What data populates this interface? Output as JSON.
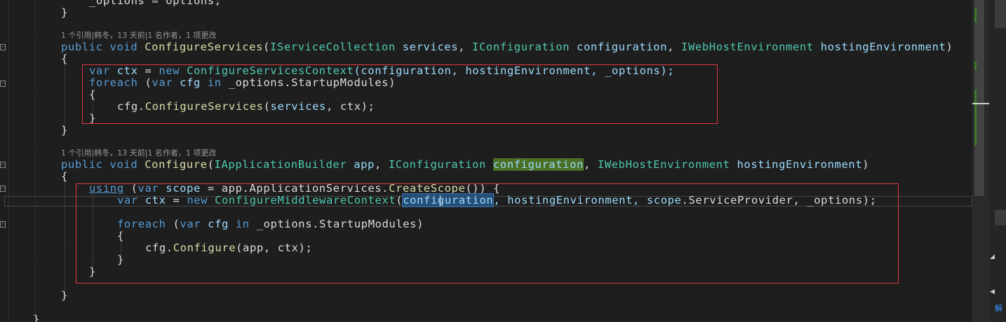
{
  "code_lens": {
    "text_1": "1 个引用|韩冬，13 天前|1 名作者，1 项更改",
    "text_2": "1 个引用|韩冬，13 天前|1 名作者，1 项更改"
  },
  "code": {
    "l0": {
      "name": "_options",
      "op": " = ",
      "val": "options",
      "end": ";"
    },
    "l1": {
      "brace": "}"
    },
    "l2": {
      "kw1": "public",
      "kw2": "void",
      "method": "ConfigureServices",
      "p0": "(",
      "t1": "IServiceCollection",
      "a1": "services",
      "sep1": ", ",
      "t2": "IConfiguration",
      "a2": "configuration",
      "sep2": ", ",
      "t3": "IWebHostEnvironment",
      "a3": "hostingEnvironment",
      "p1": ")"
    },
    "l3": {
      "brace": "{"
    },
    "l4": {
      "kw1": "var",
      "v": "ctx",
      "op": " = ",
      "kw2": "new",
      "type": "ConfigureServicesContext",
      "args": "(configuration, hostingEnvironment, _options);"
    },
    "l5": {
      "kw1": "foreach",
      "p0": " (",
      "kw2": "var",
      "v": "cfg",
      "kw3": "in",
      "rest": "_options.StartupModules)"
    },
    "l6": {
      "brace": "{"
    },
    "l7": {
      "obj": "cfg.",
      "method": "ConfigureServices",
      "args1": "(",
      "arg": "services",
      "args2": ", ctx);"
    },
    "l8": {
      "brace": "}"
    },
    "l9": {
      "brace": "}"
    },
    "l10": {
      "kw1": "public",
      "kw2": "void",
      "method": "Configure",
      "p0": "(",
      "t1": "IApplicationBuilder",
      "a1": "app",
      "sep1": ", ",
      "t2": "IConfiguration",
      "a2": "configuration",
      "sep2": ", ",
      "t3": "IWebHostEnvironment",
      "a3": "hostingEnvironment",
      "p1": ")"
    },
    "l11": {
      "brace": "{"
    },
    "l12": {
      "kw1": "using",
      "p0": " (",
      "kw2": "var",
      "v": "scope",
      "op": " = ",
      "obj": "app.ApplicationServices.",
      "method": "CreateScope",
      "rest": "()) {"
    },
    "l13": {
      "kw1": "var",
      "v": "ctx",
      "op": " = ",
      "kw2": "new",
      "type": "ConfigureMiddlewareContext",
      "p0": "(",
      "sel": "configuration",
      "rest1": ", hostingEnvironment, ",
      "scope": "scope",
      "rest2": ".ServiceProvider, _options);"
    },
    "l15": {
      "kw1": "foreach",
      "p0": " (",
      "kw2": "var",
      "v": "cfg",
      "kw3": "in",
      "rest": "_options.StartupModules)"
    },
    "l16": {
      "brace": "{"
    },
    "l17": {
      "obj": "cfg.",
      "method": "Configure",
      "args": "(app, ctx);"
    },
    "l18": {
      "brace": "}"
    },
    "l19": {
      "brace": "}"
    },
    "l21": {
      "brace": "}"
    },
    "l22": {
      "brace": "}"
    }
  },
  "side_panel": {
    "label": "解"
  },
  "colors": {
    "background": "#1e1e1e",
    "keyword": "#569cd6",
    "type": "#4ec9b0",
    "method": "#dcdcaa",
    "parameter": "#9cdcfe",
    "annotation_box": "#e0383e",
    "highlight_green": "#4b6f25",
    "selection": "#264f78"
  }
}
